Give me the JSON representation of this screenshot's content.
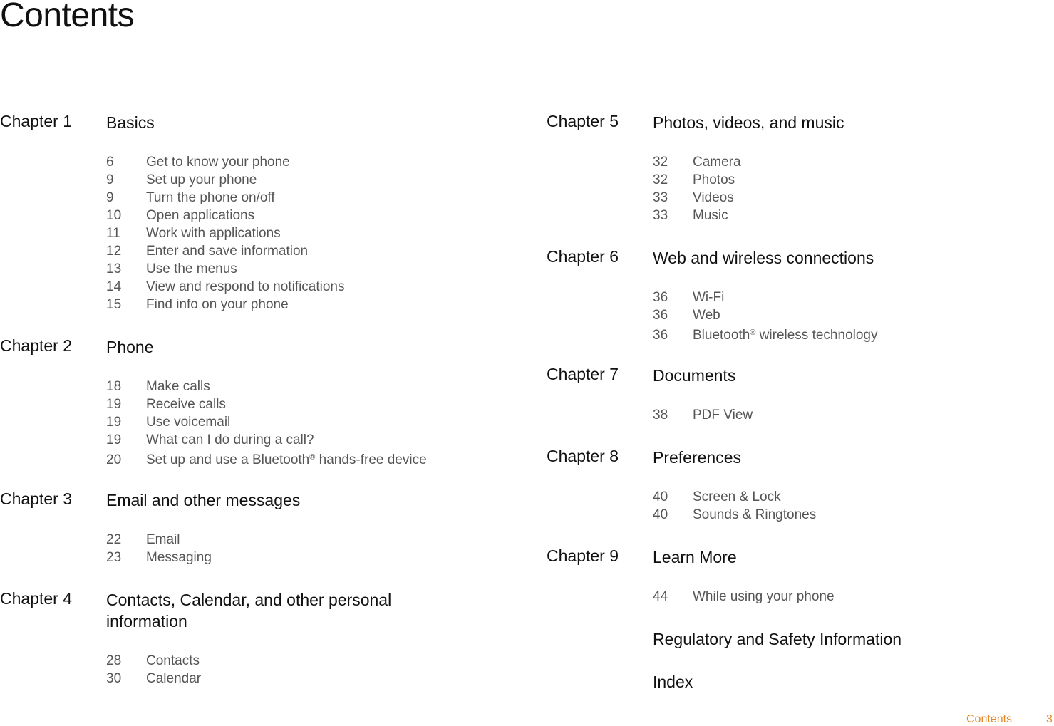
{
  "page": {
    "title": "Contents",
    "footer": {
      "label": "Contents",
      "page_number": "3",
      "accent_color": "#e8892b"
    }
  },
  "left_column": [
    {
      "label": "Chapter 1",
      "title": "Basics",
      "entries": [
        {
          "page": "6",
          "text": "Get to know your phone"
        },
        {
          "page": "9",
          "text": "Set up your phone"
        },
        {
          "page": "9",
          "text": "Turn the phone on/off"
        },
        {
          "page": "10",
          "text": "Open applications"
        },
        {
          "page": "11",
          "text": "Work with applications"
        },
        {
          "page": "12",
          "text": "Enter and save information"
        },
        {
          "page": "13",
          "text": "Use the menus"
        },
        {
          "page": "14",
          "text": "View and respond to notifications"
        },
        {
          "page": "15",
          "text": "Find info on your phone"
        }
      ]
    },
    {
      "label": "Chapter 2",
      "title": "Phone",
      "entries": [
        {
          "page": "18",
          "text": "Make calls"
        },
        {
          "page": "19",
          "text": "Receive calls"
        },
        {
          "page": "19",
          "text": "Use voicemail"
        },
        {
          "page": "19",
          "text": "What can I do during a call?"
        },
        {
          "page": "20",
          "text": "Set up and use a Bluetooth® hands-free device"
        }
      ]
    },
    {
      "label": "Chapter 3",
      "title": "Email and other messages",
      "entries": [
        {
          "page": "22",
          "text": "Email"
        },
        {
          "page": "23",
          "text": "Messaging"
        }
      ]
    },
    {
      "label": "Chapter 4",
      "title": "Contacts, Calendar, and other personal information",
      "entries": [
        {
          "page": "28",
          "text": "Contacts"
        },
        {
          "page": "30",
          "text": "Calendar"
        }
      ]
    }
  ],
  "right_column": [
    {
      "label": "Chapter 5",
      "title": "Photos, videos, and music",
      "entries": [
        {
          "page": "32",
          "text": "Camera"
        },
        {
          "page": "32",
          "text": "Photos"
        },
        {
          "page": "33",
          "text": "Videos"
        },
        {
          "page": "33",
          "text": "Music"
        }
      ]
    },
    {
      "label": "Chapter 6",
      "title": "Web and wireless connections",
      "entries": [
        {
          "page": "36",
          "text": "Wi-Fi"
        },
        {
          "page": "36",
          "text": "Web"
        },
        {
          "page": "36",
          "text": "Bluetooth® wireless technology"
        }
      ]
    },
    {
      "label": "Chapter 7",
      "title": "Documents",
      "entries": [
        {
          "page": "38",
          "text": "PDF View"
        }
      ]
    },
    {
      "label": "Chapter 8",
      "title": "Preferences",
      "entries": [
        {
          "page": "40",
          "text": "Screen & Lock"
        },
        {
          "page": "40",
          "text": "Sounds & Ringtones"
        }
      ]
    },
    {
      "label": "Chapter 9",
      "title": "Learn More",
      "entries": [
        {
          "page": "44",
          "text": "While using your phone"
        }
      ]
    },
    {
      "label": "",
      "title": "Regulatory and Safety Information",
      "entries": []
    },
    {
      "label": "",
      "title": "Index",
      "entries": []
    }
  ]
}
